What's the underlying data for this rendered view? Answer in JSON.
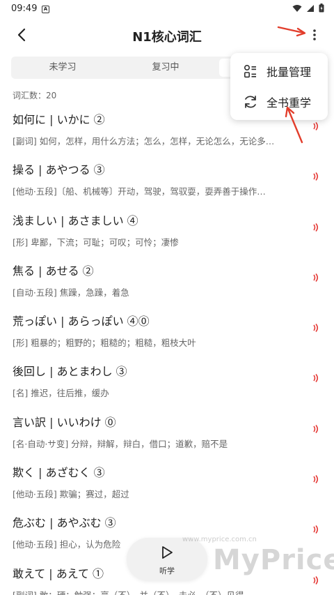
{
  "status_bar": {
    "time": "09:49",
    "notification_icon": "A"
  },
  "header": {
    "title": "N1核心词汇"
  },
  "tabs": [
    {
      "label": "未学习",
      "active": false
    },
    {
      "label": "复习中",
      "active": false
    },
    {
      "label": "",
      "active": true
    }
  ],
  "word_count": "词汇数：20",
  "menu": {
    "items": [
      {
        "label": "批量管理",
        "icon": "grid-manage-icon"
      },
      {
        "label": "全书重学",
        "icon": "refresh-icon"
      }
    ]
  },
  "words": [
    {
      "word": "如何に | いかに ②",
      "meaning": "[副词] 如何，怎样，用什么方法；怎么，怎样，无论怎么，无论多…"
    },
    {
      "word": "操る | あやつる ③",
      "meaning": "[他动·五段]〔船、机械等〕开动，驾驶，驾驭耍，耍弄善于操作…"
    },
    {
      "word": "浅ましい | あさましい ④",
      "meaning": "[形] 卑鄙，下流；可耻；可叹；可怜；凄惨"
    },
    {
      "word": "焦る | あせる ②",
      "meaning": "[自动·五段] 焦躁，急躁，着急"
    },
    {
      "word": "荒っぽい | あらっぽい ④⓪",
      "meaning": "[形] 粗暴的；粗野的；粗糙的；粗糙，粗枝大叶"
    },
    {
      "word": "後回し | あとまわし ③",
      "meaning": "[名] 推迟，往后推，缓办"
    },
    {
      "word": "言い訳 | いいわけ ⓪",
      "meaning": "[名·自动·サ变] 分辩，辩解，辩白，借口；道歉，赔不是"
    },
    {
      "word": "欺く | あざむく ③",
      "meaning": "[他动·五段] 欺骗；赛过，超过"
    },
    {
      "word": "危ぶむ | あやぶむ ③",
      "meaning": "[他动·五段] 担心，认为危险"
    },
    {
      "word": "敢えて | あえて ①",
      "meaning": "[副词] 敢；硬；勉强；毫（不），并（不），未必，（不）见得"
    }
  ],
  "listen_button": {
    "label": "听学"
  },
  "watermark": {
    "text": "MyPrice",
    "url": "www.myprice.com.cn"
  },
  "colors": {
    "accent_red": "#e53935",
    "arrow_red": "#e23d2b"
  }
}
